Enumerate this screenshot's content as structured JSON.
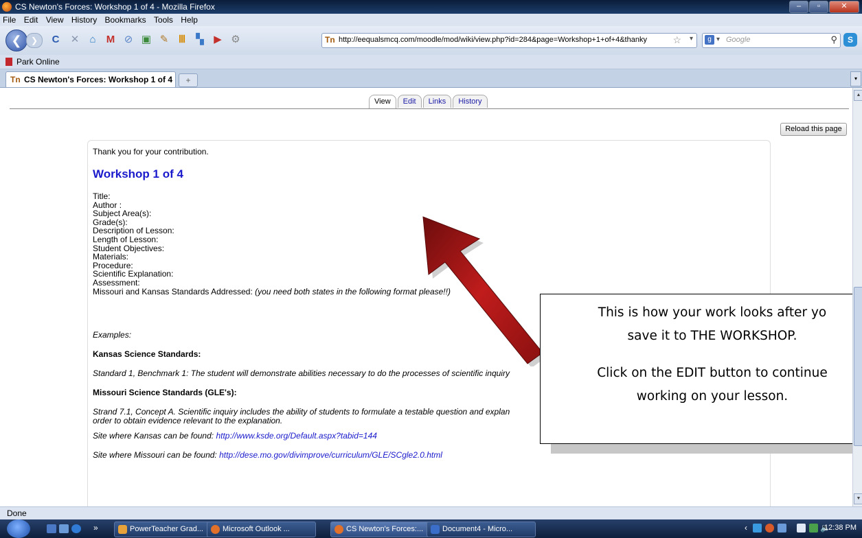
{
  "window": {
    "title": "CS Newton's Forces: Workshop 1 of 4 - Mozilla Firefox"
  },
  "menu": [
    "File",
    "Edit",
    "View",
    "History",
    "Bookmarks",
    "Tools",
    "Help"
  ],
  "navbar": {
    "url": "http://eequalsmcq.com/moodle/mod/wiki/view.php?id=284&page=Workshop+1+of+4&thanky",
    "search_placeholder": "Google"
  },
  "bookmarks": [
    {
      "label": "Park Online"
    }
  ],
  "browser_tab": {
    "label": "CS Newton's Forces: Workshop 1 of 4",
    "newtab_symbol": "+"
  },
  "wiki_tabs": [
    {
      "label": "View",
      "active": true
    },
    {
      "label": "Edit",
      "active": false
    },
    {
      "label": "Links",
      "active": false
    },
    {
      "label": "History",
      "active": false
    }
  ],
  "reload_button": "Reload this page",
  "page": {
    "thanks": "Thank you for your contribution.",
    "heading": "Workshop 1 of 4",
    "fields": [
      "Title:",
      "Author :",
      "Subject Area(s):",
      "Grade(s):",
      "Description of Lesson:",
      "Length of Lesson:",
      "Student Objectives:",
      "Materials:",
      "Procedure:",
      "Scientific Explanation:",
      "Assessment:"
    ],
    "standards_label": "Missouri and Kansas Standards Addressed: ",
    "standards_note": "(you need both states in the following format please!!)",
    "examples": "Examples:",
    "kansas_heading": "Kansas Science Standards:",
    "kansas_text": "Standard 1, Benchmark 1: The student will demonstrate abilities necessary to do the processes of scientific inquiry",
    "missouri_heading": "Missouri Science Standards (GLE's):",
    "missouri_text_1": "Strand 7.1, Concept A. Scientific inquiry includes the ability of students to formulate a testable question and explan",
    "missouri_text_2": "order to obtain evidence relevant to the explanation.",
    "kansas_site_label": "Site where Kansas can be found: ",
    "kansas_site_link": "http://www.ksde.org/Default.aspx?tabid=144",
    "missouri_site_label": "Site where Missouri can be found: ",
    "missouri_site_link": "http://dese.mo.gov/divimprove/curriculum/GLE/SCgle2.0.html"
  },
  "callout": {
    "line1": "This is how your work looks after yo",
    "line2": "save it to THE WORKSHOP.",
    "line3": "Click on the EDIT button to continue",
    "line4": "working on your lesson."
  },
  "status": "Done",
  "taskbar": {
    "items": [
      {
        "label": "PowerTeacher Grad..."
      },
      {
        "label": "Microsoft Outlook ..."
      },
      {
        "label": "CS Newton's Forces:..."
      },
      {
        "label": "Document4 - Micro..."
      }
    ],
    "chevron": "»",
    "clock": "12:38 PM"
  },
  "colors": {
    "link": "#1a1acc",
    "arrow": "#b51a1a",
    "titlebar": "#0b1d3a"
  }
}
